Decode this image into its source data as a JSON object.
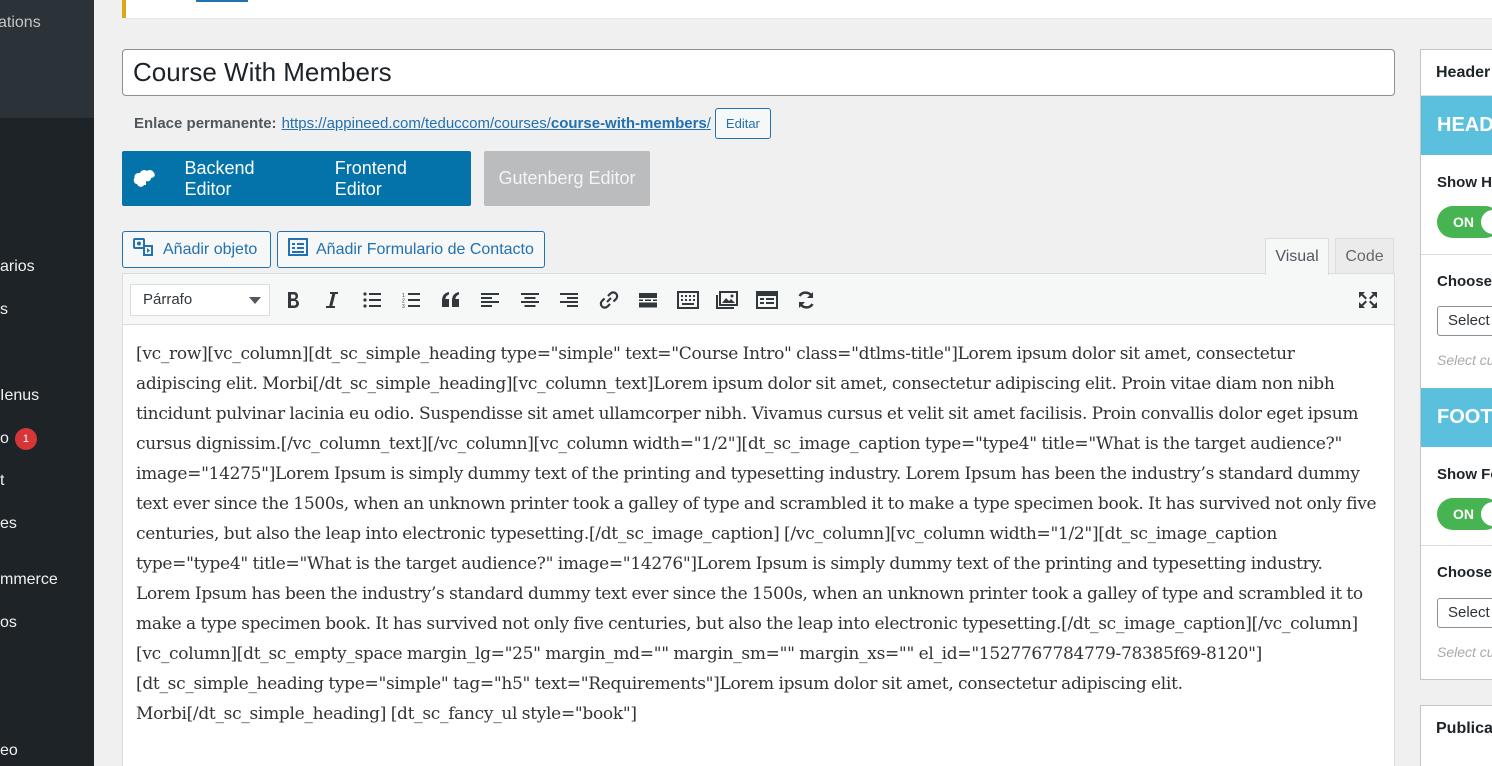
{
  "sidebar": {
    "items": [
      {
        "label": "ations",
        "dim": true
      },
      {
        "label": "arios"
      },
      {
        "label": "s"
      },
      {
        "label": "Ienus"
      },
      {
        "label": "o",
        "badge": "1"
      },
      {
        "label": "t"
      },
      {
        "label": "es"
      },
      {
        "label": "mmerce"
      },
      {
        "label": "os"
      },
      {
        "label": "eo"
      }
    ]
  },
  "post": {
    "title": "Course With Members",
    "permalink_label": "Enlace permanente:",
    "permalink_base": "https://appineed.com/teduccom/courses/",
    "permalink_slug": "course-with-members",
    "permalink_trail": "/",
    "edit_slug_label": "Editar"
  },
  "editor_switch": {
    "backend": "Backend Editor",
    "frontend": "Frontend Editor",
    "gutenberg": "Gutenberg Editor"
  },
  "media_buttons": {
    "add_media": "Añadir objeto",
    "add_form": "Añadir Formulario de Contacto"
  },
  "tabs": {
    "visual": "Visual",
    "code": "Code"
  },
  "toolbar": {
    "format_value": "Párrafo",
    "buttons": [
      "bold-icon",
      "italic-icon",
      "bullet-list-icon",
      "numbered-list-icon",
      "blockquote-icon",
      "align-left-icon",
      "align-center-icon",
      "align-right-icon",
      "link-icon",
      "read-more-icon",
      "toolbar-toggle-icon",
      "add-media-icon",
      "form-icon",
      "refresh-icon",
      "fullscreen-icon"
    ]
  },
  "content": {
    "text": "[vc_row][vc_column][dt_sc_simple_heading type=\"simple\" text=\"Course Intro\" class=\"dtlms-title\"]Lorem ipsum dolor sit amet, consectetur adipiscing elit. Morbi[/dt_sc_simple_heading][vc_column_text]Lorem ipsum dolor sit amet, consectetur adipiscing elit. Proin vitae diam non nibh tincidunt pulvinar lacinia eu odio. Suspendisse sit amet ullamcorper nibh. Vivamus cursus et velit sit amet facilisis. Proin convallis dolor eget ipsum cursus dignissim.[/vc_column_text][/vc_column][vc_column width=\"1/2\"][dt_sc_image_caption type=\"type4\" title=\"What is the target audience?\" image=\"14275\"]Lorem Ipsum is simply dummy text of the printing and typesetting industry. Lorem Ipsum has been the industry’s standard dummy text ever since the 1500s, when an unknown printer took a galley of type and scrambled it to make a type specimen book. It has survived not only five centuries, but also the leap into electronic typesetting.[/dt_sc_image_caption] [/vc_column][vc_column width=\"1/2\"][dt_sc_image_caption type=\"type4\" title=\"What is the target audience?\" image=\"14276\"]Lorem Ipsum is simply dummy text of the printing and typesetting industry. Lorem Ipsum has been the industry’s standard dummy text ever since the 1500s, when an unknown printer took a galley of type and scrambled it to make a type specimen book. It has survived not only five centuries, but also the leap into electronic typesetting.[/dt_sc_image_caption][/vc_column][vc_column][dt_sc_empty_space margin_lg=\"25\" margin_md=\"\" margin_sm=\"\" margin_xs=\"\" el_id=\"1527767784779-78385f69-8120\"][dt_sc_simple_heading type=\"simple\" tag=\"h5\" text=\"Requirements\"]Lorem ipsum dolor sit amet, consectetur adipiscing elit. Morbi[/dt_sc_simple_heading] [dt_sc_fancy_ul style=\"book\"]"
  },
  "right_panel": {
    "header_title": "Header",
    "header_band": "HEAD",
    "show_header": "Show H",
    "toggle_on": "ON",
    "choose_1": "Choose",
    "select_1": "Select",
    "hint_1": "Select cu",
    "footer_band": "FOOT",
    "show_footer": "Show Fo",
    "choose_2": "Choose",
    "select_2": "Select",
    "hint_2": "Select cu",
    "publish_title": "Publica"
  },
  "colors": {
    "admin_sidebar": "#1d2327",
    "accent": "#2271b1",
    "wpbakery": "#0473aa",
    "band": "#5bc0de",
    "toggle_on": "#46b450",
    "badge": "#d63638"
  }
}
